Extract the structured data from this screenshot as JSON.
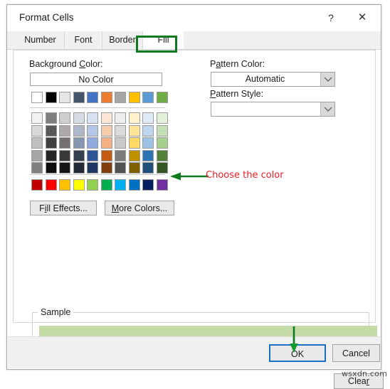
{
  "window": {
    "title": "Format Cells",
    "help_label": "?",
    "close_label": "✕"
  },
  "tabs": [
    {
      "id": "number",
      "label": "Number",
      "active": false
    },
    {
      "id": "font",
      "label": "Font",
      "active": false
    },
    {
      "id": "border",
      "label": "Border",
      "active": false
    },
    {
      "id": "fill",
      "label": "Fill",
      "active": true
    }
  ],
  "fill_tab": {
    "background_color": {
      "label_pre": "Background ",
      "label_accel": "C",
      "label_post": "olor:",
      "no_color_label": "No Color",
      "theme_top_row": [
        "#ffffff",
        "#000000",
        "#e7e6e6",
        "#44546a",
        "#4472c4",
        "#ed7d31",
        "#a5a5a5",
        "#ffc000",
        "#5b9bd5",
        "#70ad47"
      ],
      "theme_grid": [
        [
          "#f2f2f2",
          "#7f7f7f",
          "#d0cece",
          "#d6dce4",
          "#d9e2f3",
          "#fbe5d5",
          "#ededed",
          "#fff2cc",
          "#deeaf6",
          "#e2efd9"
        ],
        [
          "#d9d9d9",
          "#595959",
          "#aeaaaa",
          "#adb9ca",
          "#b4c6e7",
          "#f7caac",
          "#dbdbdb",
          "#ffe599",
          "#bdd6ee",
          "#c5e0b3"
        ],
        [
          "#bfbfbf",
          "#3f3f3f",
          "#757070",
          "#8496b0",
          "#8faadc",
          "#f4b083",
          "#c9c9c9",
          "#ffd965",
          "#9cc3e5",
          "#a8d08d"
        ],
        [
          "#a6a6a6",
          "#262626",
          "#3a3838",
          "#333f4f",
          "#2f5496",
          "#c55a11",
          "#7b7b7b",
          "#bf9000",
          "#2e75b5",
          "#538135"
        ],
        [
          "#808080",
          "#0d0d0d",
          "#171616",
          "#222a35",
          "#1f3863",
          "#833c0b",
          "#525252",
          "#7f6000",
          "#1e4e79",
          "#375623"
        ]
      ],
      "standard_row": [
        "#c00000",
        "#ff0000",
        "#ffc000",
        "#ffff00",
        "#92d050",
        "#00b050",
        "#00b0f0",
        "#0070c0",
        "#002060",
        "#7030a0"
      ],
      "selected_swatch": {
        "row": 1,
        "col": 9,
        "color": "#c5e0b3"
      }
    },
    "fill_effects_button": {
      "label_pre": "F",
      "label_accel": "i",
      "label_post": "ll Effects..."
    },
    "more_colors_button": {
      "label_pre": "",
      "label_accel": "M",
      "label_post": "ore Colors..."
    },
    "pattern_color": {
      "label_pre": "P",
      "label_accel": "a",
      "label_post": "ttern Color:",
      "value": "Automatic"
    },
    "pattern_style": {
      "label_pre": "",
      "label_accel": "P",
      "label_post": "attern Style:",
      "value": ""
    },
    "sample": {
      "legend": "Sample",
      "fill_color": "#c5dca8"
    },
    "clear_button": {
      "label_pre": "Clea",
      "label_accel": "r",
      "label_post": ""
    }
  },
  "footer": {
    "ok_label": "OK",
    "cancel_label": "Cancel"
  },
  "annotations": {
    "choose_color_text": "Choose the color",
    "arrow_color": "#0f7b20",
    "text_color": "#ee1c24",
    "highlight_color": "#0f7b20"
  },
  "watermark": {
    "text": "wsxdn.com"
  }
}
